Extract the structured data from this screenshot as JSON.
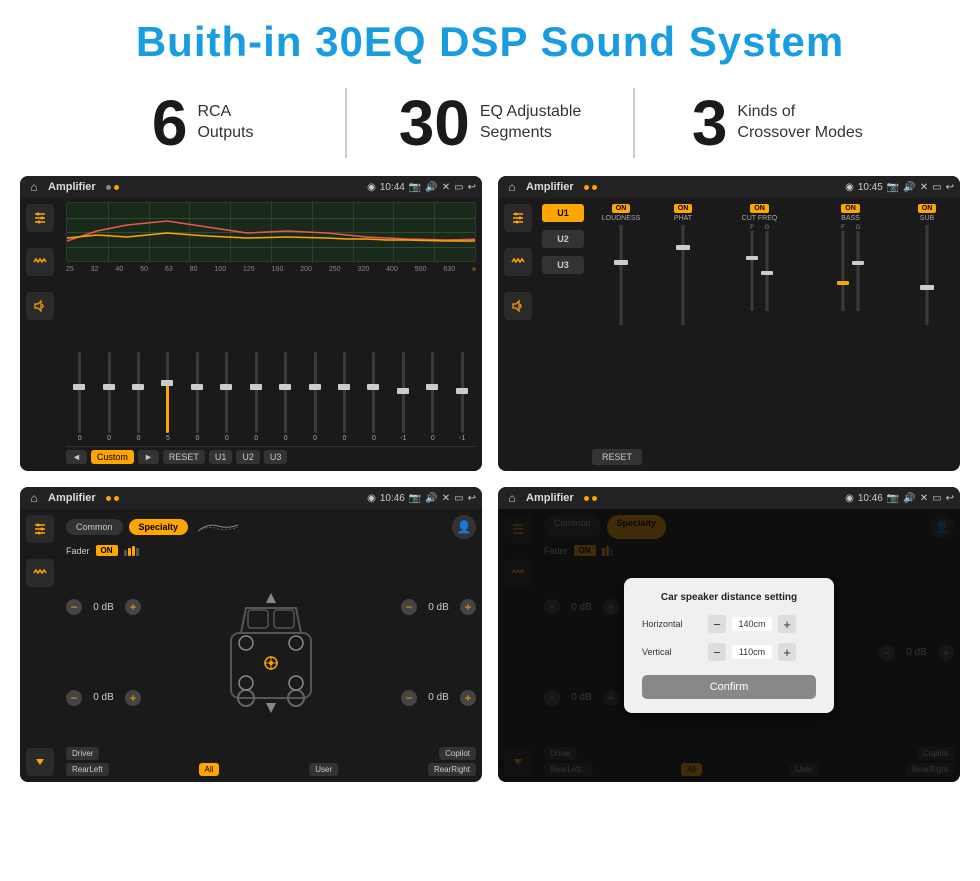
{
  "page": {
    "title": "Buith-in 30EQ DSP Sound System",
    "bg_color": "#ffffff"
  },
  "stats": {
    "items": [
      {
        "number": "6",
        "text_line1": "RCA",
        "text_line2": "Outputs"
      },
      {
        "number": "30",
        "text_line1": "EQ Adjustable",
        "text_line2": "Segments"
      },
      {
        "number": "3",
        "text_line1": "Kinds of",
        "text_line2": "Crossover Modes"
      }
    ]
  },
  "screen1": {
    "app_name": "Amplifier",
    "time": "10:44",
    "eq_labels": [
      "25",
      "32",
      "40",
      "50",
      "63",
      "80",
      "100",
      "125",
      "160",
      "200",
      "250",
      "320",
      "400",
      "500",
      "630"
    ],
    "eq_values": [
      "0",
      "0",
      "0",
      "5",
      "0",
      "0",
      "0",
      "0",
      "0",
      "0",
      "0",
      "-1",
      "0",
      "-1"
    ],
    "bottom_buttons": [
      "◄",
      "Custom",
      "►",
      "RESET",
      "U1",
      "U2",
      "U3"
    ],
    "graph_curves": [
      "red",
      "yellow"
    ]
  },
  "screen2": {
    "app_name": "Amplifier",
    "time": "10:45",
    "presets": [
      "U1",
      "U2",
      "U3"
    ],
    "sections": [
      {
        "label": "LOUDNESS",
        "toggle": "ON"
      },
      {
        "label": "PHAT",
        "toggle": "ON"
      },
      {
        "label": "CUT FREQ",
        "toggle": "ON"
      },
      {
        "label": "BASS",
        "toggle": "ON"
      },
      {
        "label": "SUB",
        "toggle": "ON"
      }
    ],
    "reset_label": "RESET"
  },
  "screen3": {
    "app_name": "Amplifier",
    "time": "10:46",
    "tabs": [
      "Common",
      "Specialty"
    ],
    "fader_label": "Fader",
    "fader_toggle": "ON",
    "vol_controls": [
      {
        "label": "",
        "value": "0 dB"
      },
      {
        "label": "",
        "value": "0 dB"
      },
      {
        "label": "",
        "value": "0 dB"
      },
      {
        "label": "",
        "value": "0 dB"
      }
    ],
    "speaker_buttons": [
      "Driver",
      "Copilot",
      "RearLeft",
      "All",
      "User",
      "RearRight"
    ]
  },
  "screen4": {
    "app_name": "Amplifier",
    "time": "10:46",
    "tabs": [
      "Common",
      "Specialty"
    ],
    "fader_toggle": "ON",
    "dialog": {
      "title": "Car speaker distance setting",
      "horizontal_label": "Horizontal",
      "horizontal_value": "140cm",
      "vertical_label": "Vertical",
      "vertical_value": "110cm",
      "confirm_label": "Confirm"
    },
    "right_controls": [
      {
        "value": "0 dB"
      },
      {
        "value": "0 dB"
      }
    ],
    "speaker_buttons": [
      "Driver",
      "Copilot",
      "RearLeft",
      "All",
      "User",
      "RearRight"
    ]
  },
  "icons": {
    "home": "⌂",
    "location": "◉",
    "camera": "📷",
    "volume": "🔊",
    "close": "✕",
    "minimize": "—",
    "back": "↩",
    "equalizer": "≡",
    "waveform": "〰",
    "speaker": "◎",
    "chevron_right": "▶",
    "chevron_left": "◀",
    "chevron_up": "▲",
    "chevron_down": "▼",
    "person": "👤",
    "settings": "⚙"
  }
}
